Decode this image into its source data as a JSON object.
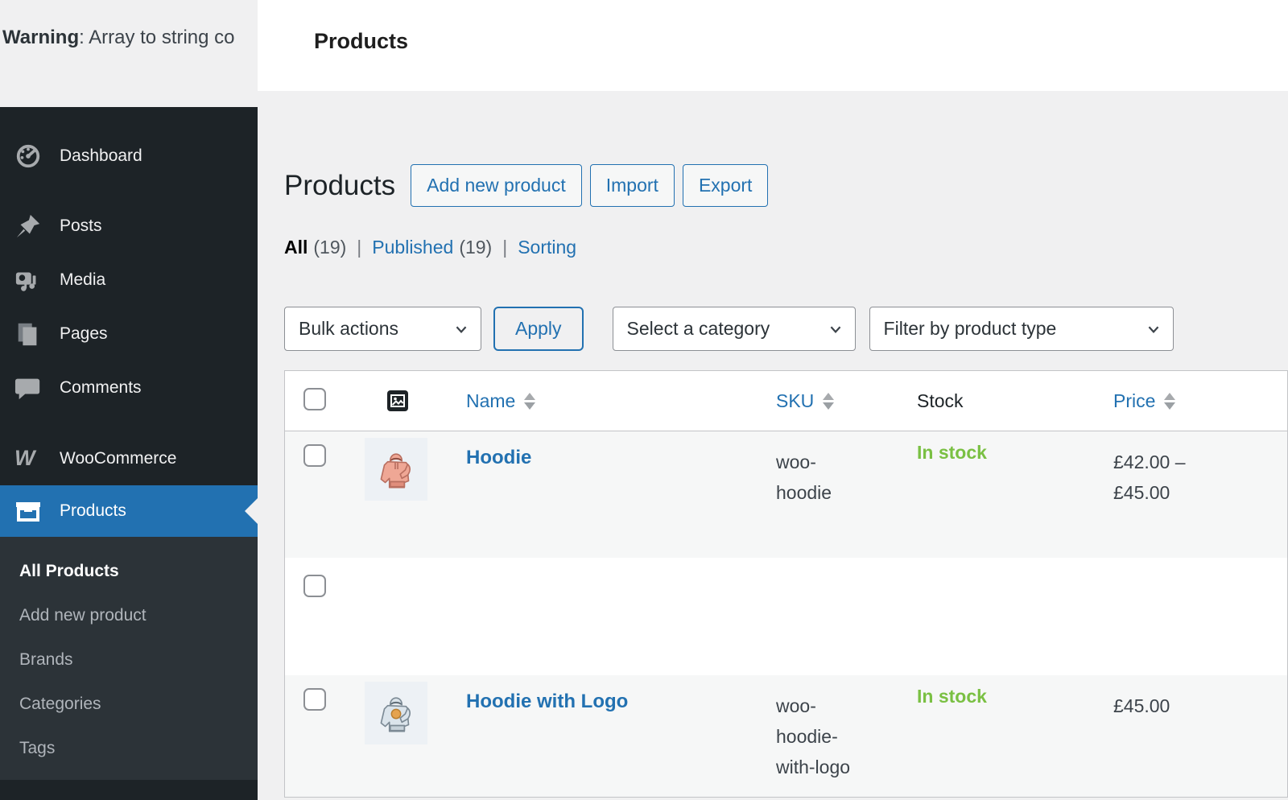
{
  "warning": {
    "prefix": "Warning",
    "text": ": Array to string co"
  },
  "top_header": {
    "title": "Products"
  },
  "sidebar": {
    "items": [
      {
        "label": "Dashboard"
      },
      {
        "label": "Posts"
      },
      {
        "label": "Media"
      },
      {
        "label": "Pages"
      },
      {
        "label": "Comments"
      },
      {
        "label": "WooCommerce"
      },
      {
        "label": "Products"
      }
    ],
    "submenu": [
      {
        "label": "All Products"
      },
      {
        "label": "Add new product"
      },
      {
        "label": "Brands"
      },
      {
        "label": "Categories"
      },
      {
        "label": "Tags"
      }
    ]
  },
  "page": {
    "title": "Products",
    "action_buttons": [
      "Add new product",
      "Import",
      "Export"
    ],
    "views": [
      {
        "label": "All",
        "count": "(19)"
      },
      {
        "label": "Published",
        "count": "(19)"
      },
      {
        "label": "Sorting",
        "count": ""
      }
    ],
    "separator": "|",
    "controls": {
      "bulk_actions": "Bulk actions",
      "apply": "Apply",
      "category_filter": "Select a category",
      "type_filter": "Filter by product type"
    }
  },
  "table": {
    "columns": {
      "name": "Name",
      "sku": "SKU",
      "stock": "Stock",
      "price": "Price"
    },
    "rows": [
      {
        "name": "Hoodie",
        "sku": "woo-hoodie",
        "stock": "In stock",
        "price": "£42.00 – £45.00"
      },
      {
        "name": "",
        "sku": "",
        "stock": "",
        "price": ""
      },
      {
        "name": "Hoodie with Logo",
        "sku": "woo-hoodie-with-logo",
        "stock": "In stock",
        "price": "£45.00"
      }
    ]
  },
  "colors": {
    "accent_blue": "#2271b1",
    "in_stock_green": "#7ac043",
    "sidebar_bg": "#1d2327",
    "submenu_bg": "#2c3338",
    "content_bg": "#f0f0f1",
    "row_alt_bg": "#f6f7f7",
    "table_border": "#c3c4c7"
  }
}
